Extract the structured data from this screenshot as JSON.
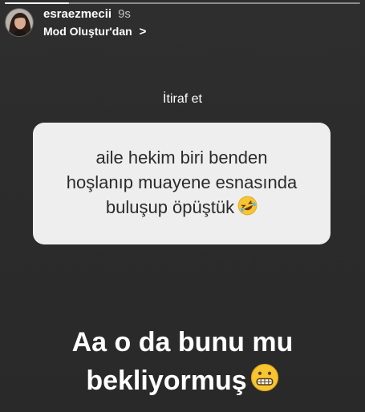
{
  "story": {
    "progress": 0.18
  },
  "header": {
    "username": "esraezmecii",
    "time": "9s",
    "mode_link": "Mod Oluştur'dan",
    "chevron": ">"
  },
  "question": {
    "label": "İtiraf et",
    "answer": "aile hekim biri benden hoşlanıp muayene esnasında buluşup öpüştük",
    "answer_lines": [
      "aile hekim biri benden",
      "hoşlanıp muayene esnasında",
      "buluşup öpüştük"
    ],
    "emoji": "rolling-on-floor-laughing-emoji"
  },
  "caption": {
    "lines": [
      "Aa o da bunu mu",
      "bekliyormuş"
    ],
    "emoji": "grimacing-face-emoji"
  },
  "colors": {
    "background": "#2b2b2b",
    "card": "#eeeeee",
    "emoji_yellow": "#f7c531"
  }
}
